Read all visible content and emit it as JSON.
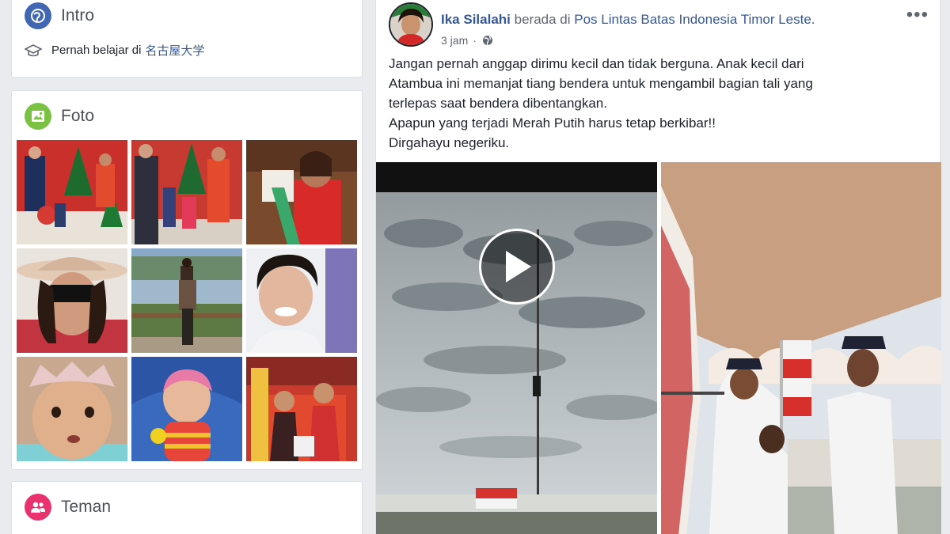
{
  "intro": {
    "title": "Intro",
    "education_prefix": "Pernah belajar di",
    "education_school": "名古屋大学"
  },
  "foto": {
    "title": "Foto",
    "photos": [
      "photo-1",
      "photo-2",
      "photo-3",
      "photo-4",
      "photo-5",
      "photo-6",
      "photo-7",
      "photo-8",
      "photo-9"
    ]
  },
  "teman": {
    "title": "Teman"
  },
  "post": {
    "author": "Ika Silalahi",
    "at_word": "berada di",
    "place": "Pos Lintas Batas Indonesia Timor Leste.",
    "time": "3 jam",
    "more": "•••",
    "text_lines": [
      "Jangan pernah anggap dirimu kecil dan tidak berguna. Anak kecil dari",
      "Atambua ini memanjat tiang bendera untuk mengambil bagian tali yang",
      "terlepas saat bendera dibentangkan.",
      "Apapun yang terjadi Merah Putih harus tetap berkibar!!",
      "Dirgahayu negeriku."
    ]
  },
  "colors": {
    "link": "#365899",
    "intro_icon": "#4267b2",
    "foto_icon": "#7bc143",
    "teman_icon": "#e8336e"
  }
}
